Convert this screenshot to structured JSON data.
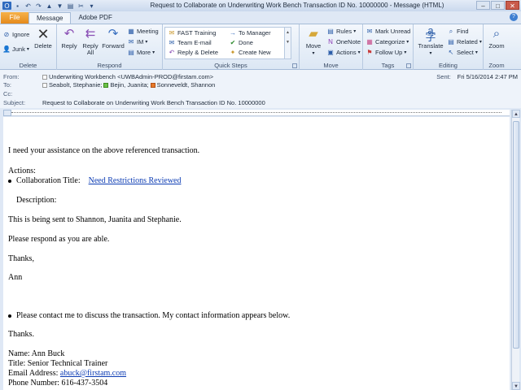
{
  "window": {
    "title": "Request to Collaborate on Underwriting Work Bench Transaction ID No. 10000000  -  Message (HTML)",
    "controls": [
      "–",
      "□",
      "✕"
    ]
  },
  "tabs": [
    {
      "label": "File"
    },
    {
      "label": "Message"
    },
    {
      "label": "Adobe PDF"
    }
  ],
  "ribbon": {
    "delete_group": {
      "label": "Delete",
      "ignore": "Ignore",
      "junk": "Junk",
      "delete": "Delete"
    },
    "respond_group": {
      "label": "Respond",
      "reply": "Reply",
      "reply_all_1": "Reply",
      "reply_all_2": "All",
      "forward": "Forward",
      "meeting": "Meeting",
      "im": "IM",
      "more": "More"
    },
    "quicksteps_group": {
      "label": "Quick Steps",
      "items": [
        "FAST Training",
        "Team E-mail",
        "Reply & Delete",
        "To Manager",
        "Done",
        "Create New"
      ]
    },
    "move_group": {
      "label": "Move",
      "move": "Move",
      "rules": "Rules",
      "onenote": "OneNote",
      "actions": "Actions"
    },
    "tags_group": {
      "label": "Tags",
      "mark_unread": "Mark Unread",
      "categorize": "Categorize",
      "follow_up": "Follow Up"
    },
    "editing_group": {
      "label": "Editing",
      "translate": "Translate",
      "find": "Find",
      "related": "Related",
      "select": "Select"
    },
    "zoom_group": {
      "label": "Zoom",
      "zoom": "Zoom"
    }
  },
  "header": {
    "from_label": "From:",
    "from_value": "Underwriting Workbench <UWBAdmin-PROD@firstam.com>",
    "to_label": "To:",
    "to_recipients": [
      "Seabolt, Stephanie;",
      "Bejin, Juanita;",
      "Sonneveldt, Shannon"
    ],
    "cc_label": "Cc:",
    "subject_label": "Subject:",
    "subject_value": "Request to Collaborate on Underwriting Work Bench Transaction ID No. 10000000",
    "sent_label": "Sent:",
    "sent_value": "Fri 5/16/2014 2:47 PM"
  },
  "body": {
    "intro": "I need your assistance on the above referenced transaction.",
    "actions_label": "Actions:",
    "collab_title_label": "Collaboration Title:",
    "collab_title_link": "Need Restrictions Reviewed",
    "description_label": "Description:",
    "sent_to": "This is being sent to Shannon, Juanita and Stephanie.",
    "respond": "Please respond as you are able.",
    "thanks1": "Thanks,",
    "signoff": "Ann",
    "contact": "Please contact me to discuss the transaction. My contact information appears below.",
    "thanks2": "Thanks.",
    "name": "Name: Ann Buck",
    "title": "Title: Senior Technical Trainer",
    "email_label": "Email Address:",
    "email_link": "abuck@firstam.com",
    "phone": "Phone Number: 616-437-3504"
  }
}
